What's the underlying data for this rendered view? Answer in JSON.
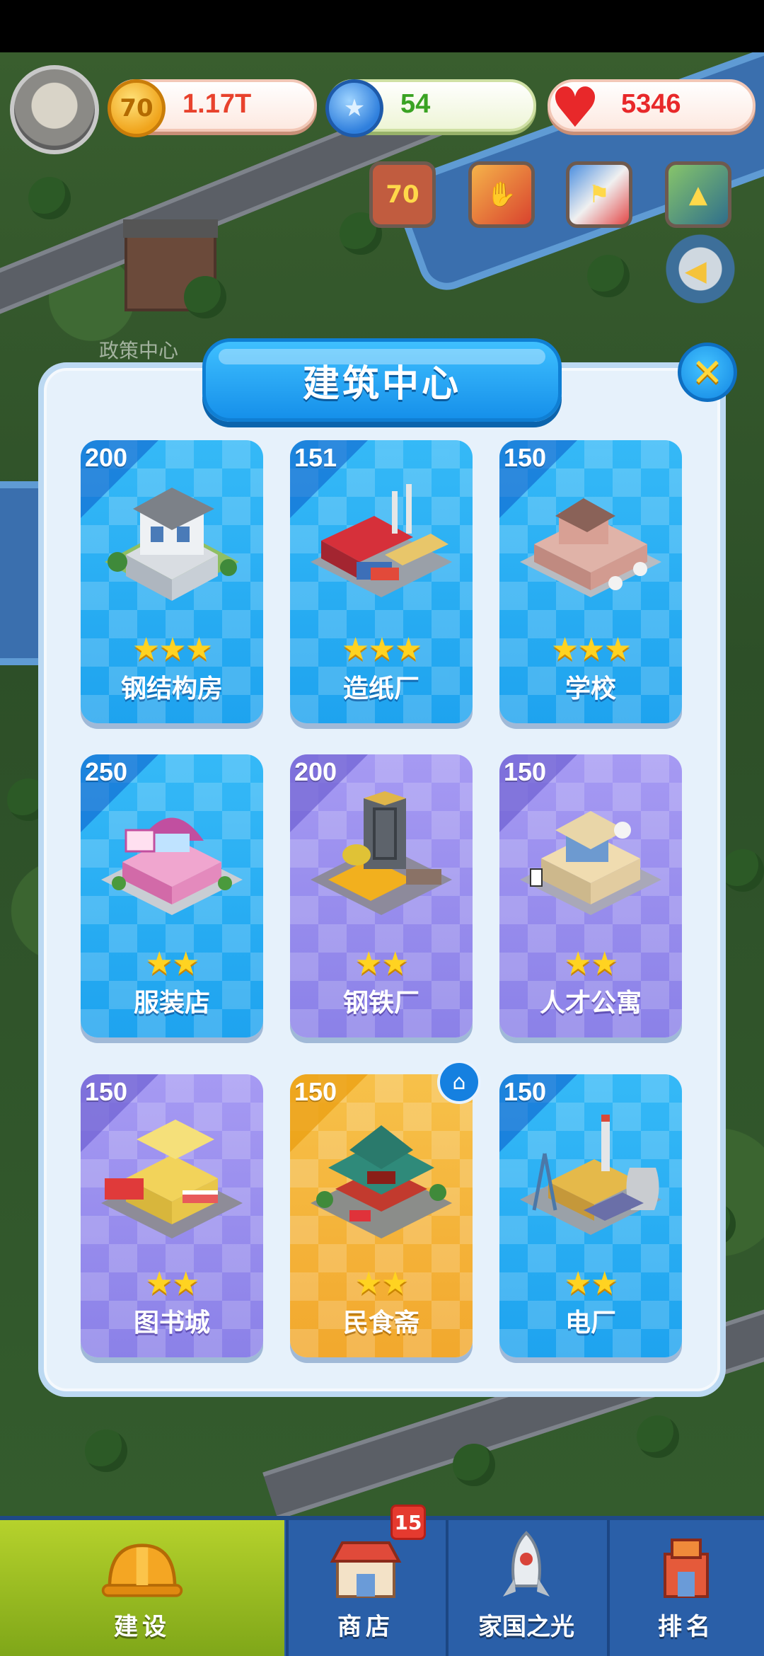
{
  "hud": {
    "coins": "1.17T",
    "coin_icon_label": "70",
    "gems": "54",
    "hearts": "5346",
    "quick_1_label": "70"
  },
  "world": {
    "policy_center_label": "政策中心"
  },
  "modal": {
    "title": "建筑中心",
    "close_glyph": "✕"
  },
  "buildings": [
    {
      "num": "200",
      "stars": "★★★",
      "name": "钢结构房"
    },
    {
      "num": "151",
      "stars": "★★★",
      "name": "造纸厂"
    },
    {
      "num": "150",
      "stars": "★★★",
      "name": "学校"
    },
    {
      "num": "250",
      "stars": "★★",
      "name": "服装店"
    },
    {
      "num": "200",
      "stars": "★★",
      "name": "钢铁厂"
    },
    {
      "num": "150",
      "stars": "★★",
      "name": "人才公寓"
    },
    {
      "num": "150",
      "stars": "★★",
      "name": "图书城"
    },
    {
      "num": "150",
      "stars": "★★",
      "name": "民食斋"
    },
    {
      "num": "150",
      "stars": "★★",
      "name": "电厂"
    }
  ],
  "nav": {
    "build": "建设",
    "shop": "商店",
    "shop_badge": "15",
    "home_light": "家国之光",
    "rank": "排名"
  },
  "colors": {
    "card_blue": "#1ea3ef",
    "card_purple": "#8b81e8",
    "card_gold": "#f2a82d",
    "coin_text": "#e8422d",
    "gem_text": "#3aa323",
    "heart_text": "#e8282a"
  }
}
